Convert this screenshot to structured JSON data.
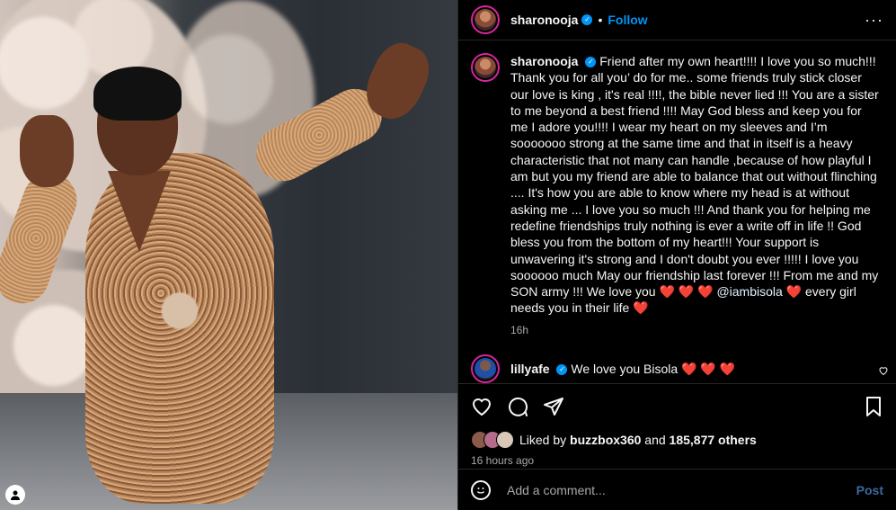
{
  "post": {
    "author": "sharonooja",
    "follow_label": "Follow",
    "separator": "•",
    "more_label": "···"
  },
  "caption": {
    "author": "sharonooja",
    "text": "Friend after my own heart!!!! I love you so much!!! Thank you for all you’ do for me.. some friends truly stick closer our love is king , it's real !!!!, the bible never lied !!! You are a sister to me beyond a best friend !!!! May God bless and keep you for me I adore you!!!! I wear my heart on my sleeves and I’m sooooooo strong at the same time and that in itself is a heavy characteristic that not many can handle ,because of how playful I am but you my friend are able to balance that out without flinching .... It's how you are able to know where my head is at without asking me ... I love you so much !!! And thank you for helping me redefine friendships truly nothing is ever a write off in life !! God bless you from the bottom of my heart!!! Your support is unwavering it's strong and I don't doubt you ever !!!!! I love you soooooo much May our friendship last forever !!! From me and my SON army !!! We love you",
    "hearts_1": "❤️ ❤️ ❤️",
    "mention": "@iambisola",
    "heart_2": "❤️",
    "tail_text": "every girl needs you in their life",
    "heart_3": "❤️",
    "time": "16h"
  },
  "comment": {
    "author": "lillyafe",
    "text": "We love you Bisola",
    "hearts": "❤️ ❤️ ❤️"
  },
  "likes": {
    "prefix": "Liked by",
    "user": "buzzbox360",
    "middle": "and",
    "count": "185,877 others"
  },
  "posted_ago": "16 hours ago",
  "add_comment": {
    "placeholder": "Add a comment...",
    "post_label": "Post"
  },
  "icons": {
    "like": "heart-icon",
    "comment": "comment-icon",
    "share": "share-icon",
    "save": "bookmark-icon",
    "emoji": "emoji-icon",
    "like_comment": "small-heart-icon"
  },
  "colors": {
    "background": "#000000",
    "text": "#f5f5f5",
    "secondary_text": "#a8a8a8",
    "accent": "#0095f6",
    "heart": "#ff3040",
    "divider": "#262626"
  }
}
